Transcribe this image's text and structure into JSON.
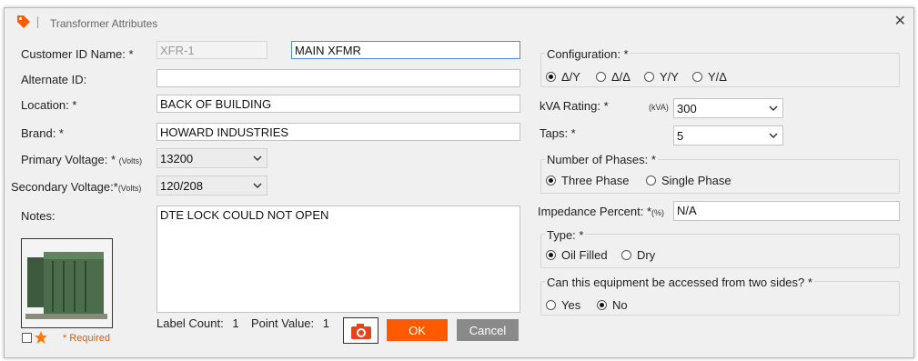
{
  "window": {
    "title": "Transformer Attributes",
    "close_glyph": "✕"
  },
  "colors": {
    "accent": "#ff5a00",
    "cancel": "#8a8a8a",
    "focus_border": "#4b8ed6"
  },
  "icons": {
    "title": "tag-icon",
    "close": "close-icon",
    "camera": "camera-icon",
    "favorite": "star-icon"
  },
  "fields": {
    "customer_id": {
      "label": "Customer ID Name: *",
      "code": "XFR-1",
      "name": "MAIN XFMR"
    },
    "alternate_id": {
      "label": "Alternate ID:",
      "value": ""
    },
    "location": {
      "label": "Location: *",
      "value": "BACK OF BUILDING"
    },
    "brand": {
      "label": "Brand: *",
      "value": "HOWARD INDUSTRIES"
    },
    "primary_voltage": {
      "label": "Primary Voltage: *",
      "units": "(Volts)",
      "value": "13200"
    },
    "secondary_voltage": {
      "label": "Secondary Voltage:*",
      "units": "(Volts)",
      "value": "120/208"
    },
    "notes": {
      "label": "Notes:",
      "value": "DTE LOCK COULD NOT OPEN"
    }
  },
  "footer": {
    "label_count_label": "Label Count:",
    "label_count": "1",
    "point_value_label": "Point Value:",
    "point_value": "1",
    "required_text": "* Required",
    "ok": "OK",
    "cancel": "Cancel"
  },
  "configuration": {
    "title": "Configuration: *",
    "options": [
      "Δ/Y",
      "Δ/Δ",
      "Y/Y",
      "Y/Δ"
    ],
    "selected": "Δ/Y"
  },
  "kva_rating": {
    "label": "kVA Rating: *",
    "units": "(kVA)",
    "value": "300"
  },
  "taps": {
    "label": "Taps: *",
    "value": "5"
  },
  "phases": {
    "title": "Number of Phases: *",
    "options": [
      "Three Phase",
      "Single Phase"
    ],
    "selected": "Three Phase"
  },
  "impedance": {
    "label": "Impedance Percent: *",
    "units": "(%)",
    "value": "N/A"
  },
  "type": {
    "title": "Type: *",
    "options": [
      "Oil Filled",
      "Dry"
    ],
    "selected": "Oil Filled"
  },
  "two_sides": {
    "title": "Can this equipment be accessed from two sides? *",
    "options": [
      "Yes",
      "No"
    ],
    "selected": "No"
  }
}
